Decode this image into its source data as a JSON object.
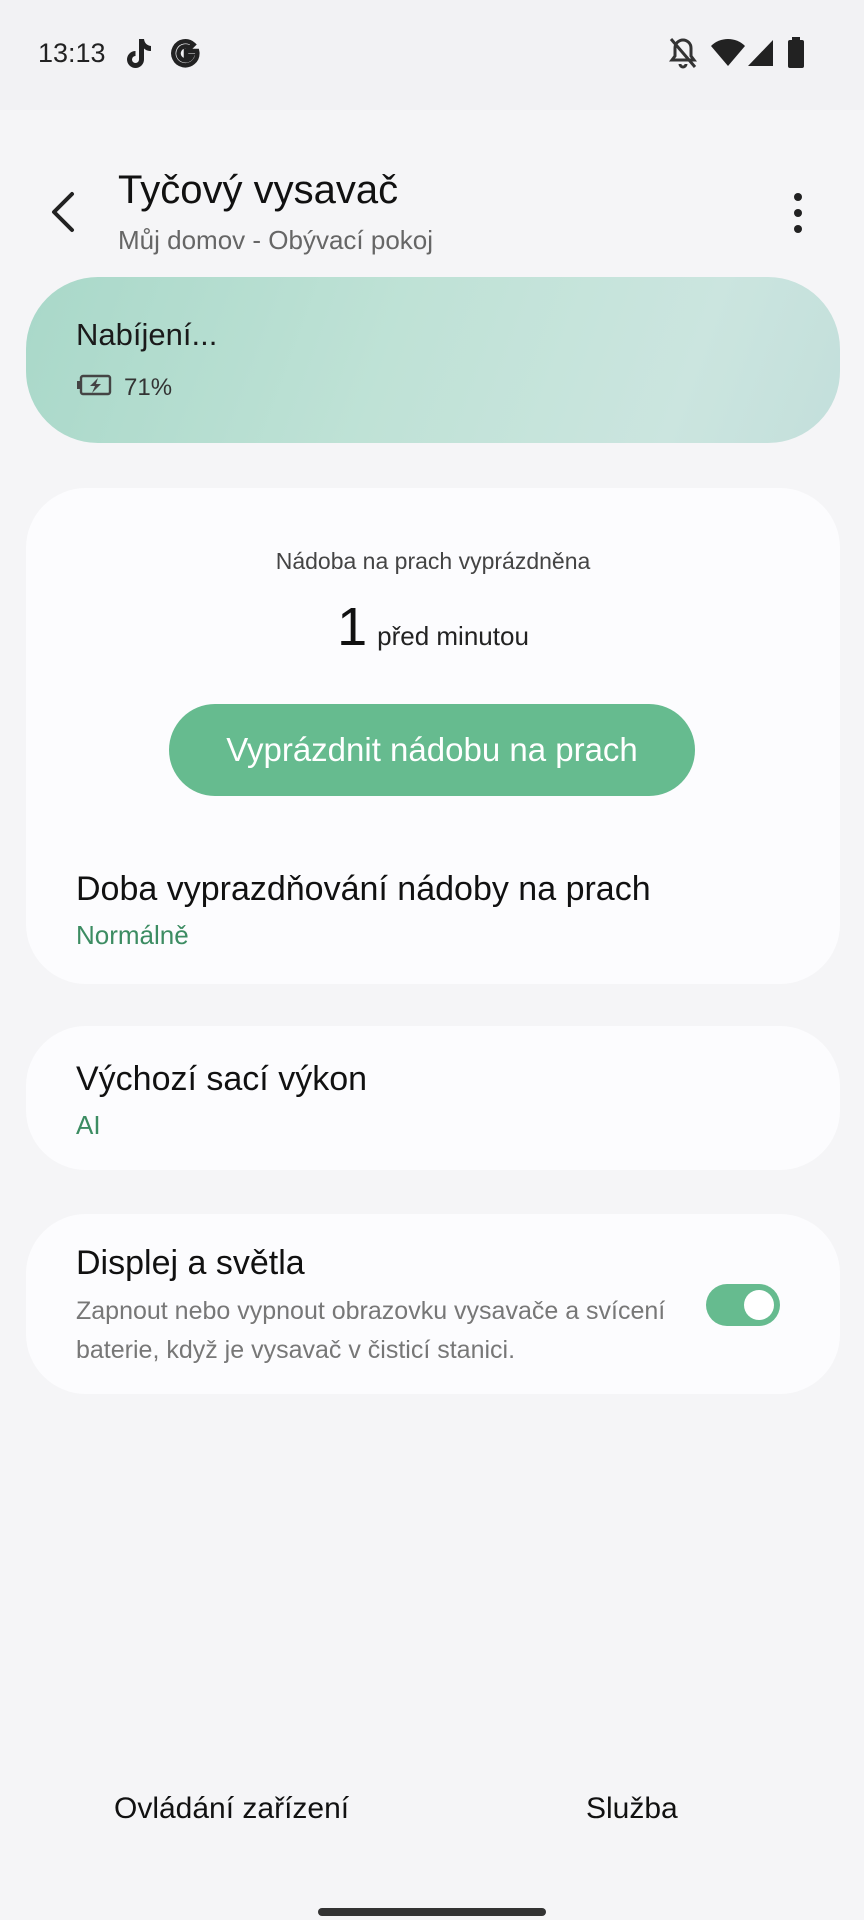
{
  "status_bar": {
    "time": "13:13",
    "icons": [
      "tiktok-icon",
      "google-icon",
      "bell-off-icon",
      "wifi-icon",
      "signal-icon",
      "battery-icon"
    ]
  },
  "header": {
    "title": "Tyčový vysavač",
    "subtitle": "Můj domov - Obývací pokoj"
  },
  "charging": {
    "status": "Nabíjení...",
    "battery_percent": "71%"
  },
  "dust_bin": {
    "label": "Nádoba na prach vyprázdněna",
    "time_value": "1",
    "time_unit": "před minutou",
    "empty_button": "Vyprázdnit nádobu na prach",
    "duration_title": "Doba vyprazdňování nádoby na prach",
    "duration_value": "Normálně"
  },
  "suction": {
    "title": "Výchozí sací výkon",
    "value": "AI"
  },
  "display": {
    "title": "Displej a světla",
    "description": "Zapnout nebo vypnout obrazovku vysavače a svícení baterie, když je vysavač v čisticí stanici.",
    "toggle_on": true
  },
  "bottom_tabs": {
    "device_control": "Ovládání zařízení",
    "service": "Služba"
  },
  "colors": {
    "accent_green": "#66bb8f",
    "value_green": "#3c8c62",
    "charge_card": "#bfe2d6"
  }
}
